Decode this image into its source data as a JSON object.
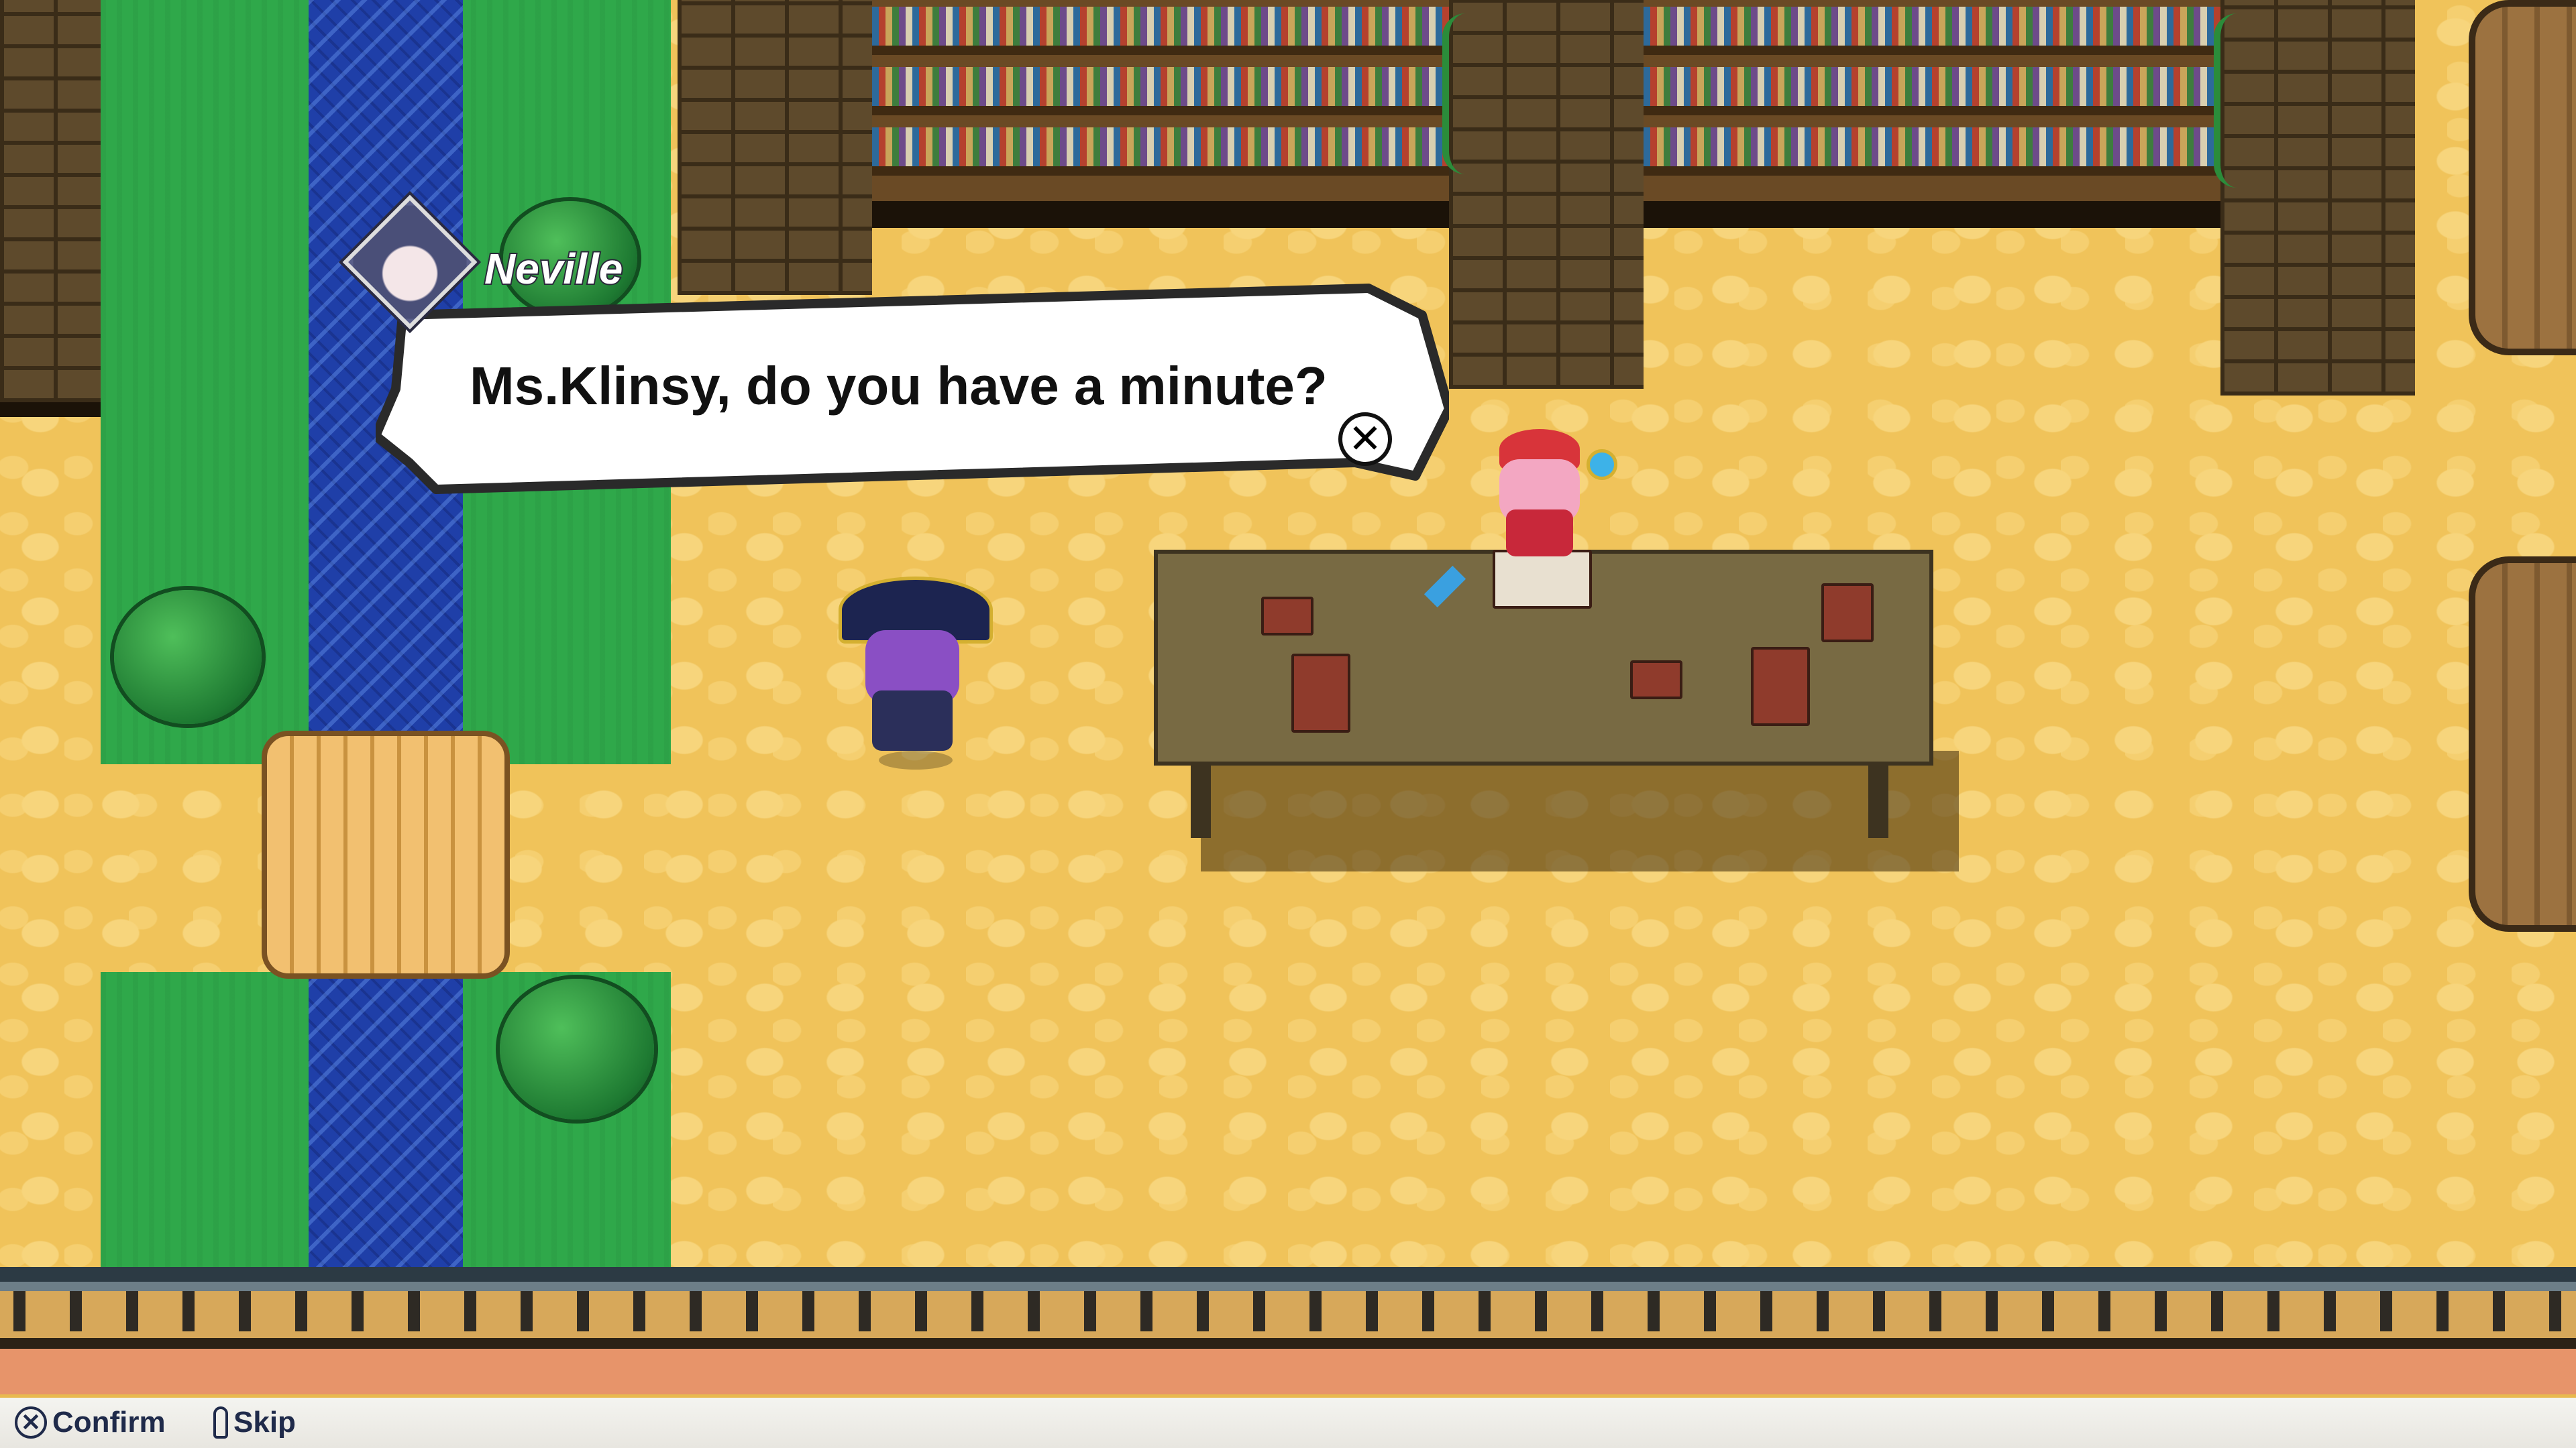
{
  "dialogue": {
    "speaker": "Neville",
    "text": "Ms.Klinsy, do you have a minute?",
    "close_glyph": "✕"
  },
  "controls": {
    "confirm_label": "Confirm",
    "confirm_glyph": "✕",
    "skip_label": "Skip"
  },
  "icons": {
    "confirm": "cross-button-icon",
    "skip": "stick-button-icon",
    "close": "close-icon"
  },
  "colors": {
    "floor": "#f0c35a",
    "grass": "#2fa84a",
    "river": "#1f3fa8",
    "bubble_fill": "#ffffff",
    "bubble_outline": "#2a2a2a"
  }
}
